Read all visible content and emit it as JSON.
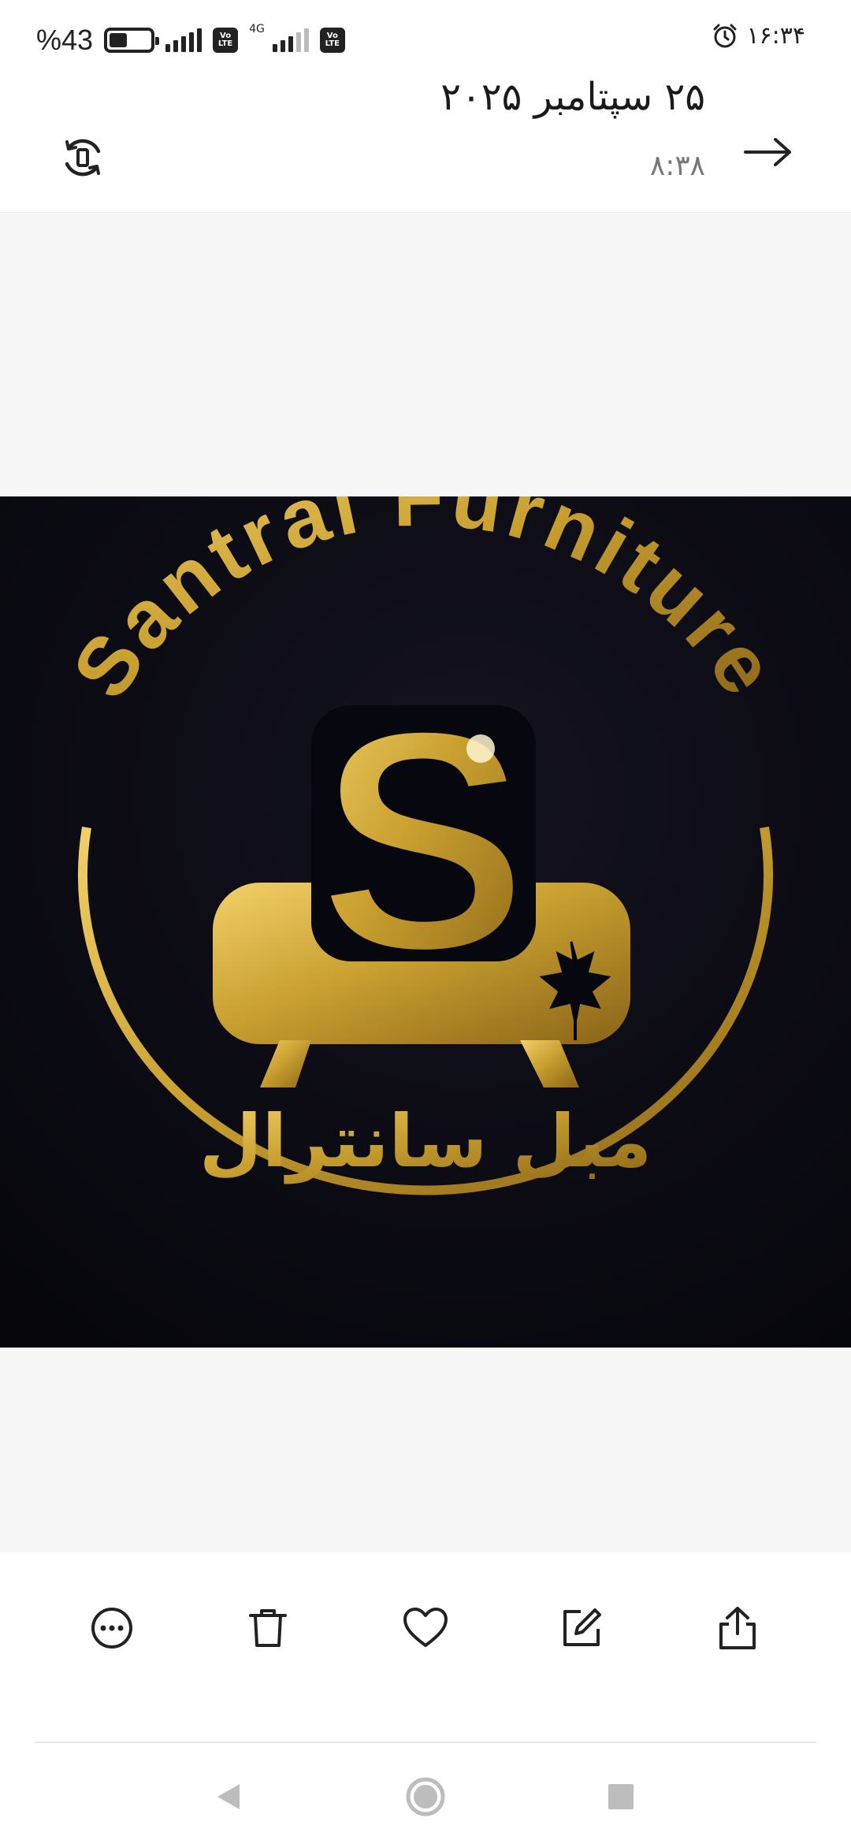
{
  "status_bar": {
    "battery_text": "%43",
    "battery_level": 0.43,
    "network_label": "4G",
    "volte_label": "Vo LTE",
    "clock": "۱۶:۳۴"
  },
  "header": {
    "date": "۲۵ سپتامبر ۲۰۲۵",
    "time": "۸:۳۸"
  },
  "photo": {
    "logo_text_en": "Santral Furniture",
    "logo_text_fa": "مبل سانترال",
    "logo_letter": "S",
    "colors": {
      "background": "#07070f",
      "gold": "#c9a030"
    }
  },
  "toolbar": {
    "items": [
      "more-icon",
      "delete-icon",
      "favorite-icon",
      "edit-icon",
      "share-icon"
    ]
  },
  "navbar": {
    "items": [
      "back-nav-icon",
      "home-nav-icon",
      "recents-nav-icon"
    ]
  }
}
